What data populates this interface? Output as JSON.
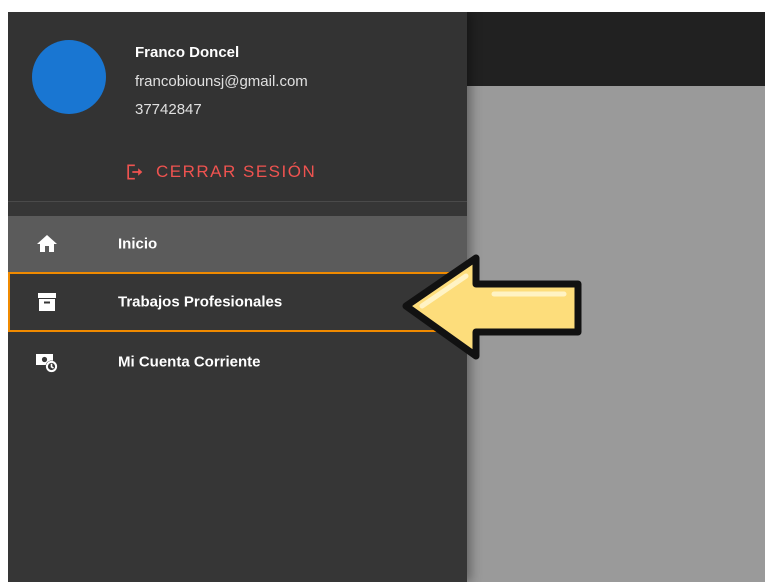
{
  "user": {
    "name": "Franco Doncel",
    "email": "francobiounsj@gmail.com",
    "id_number": "37742847",
    "avatar_color": "#1976d2"
  },
  "logout": {
    "label": "CERRAR SESIÓN",
    "icon": "logout-icon",
    "color": "#ef5350"
  },
  "nav": {
    "items": [
      {
        "label": "Inicio",
        "icon": "home-icon",
        "active": true
      },
      {
        "label": "Trabajos Profesionales",
        "icon": "archive-box-icon",
        "highlighted": true
      },
      {
        "label": "Mi Cuenta Corriente",
        "icon": "money-clock-icon"
      }
    ]
  },
  "annotation": {
    "icon": "pointer-arrow-icon",
    "fill_color": "#fddd7b",
    "highlight_color": "#f08a00"
  }
}
